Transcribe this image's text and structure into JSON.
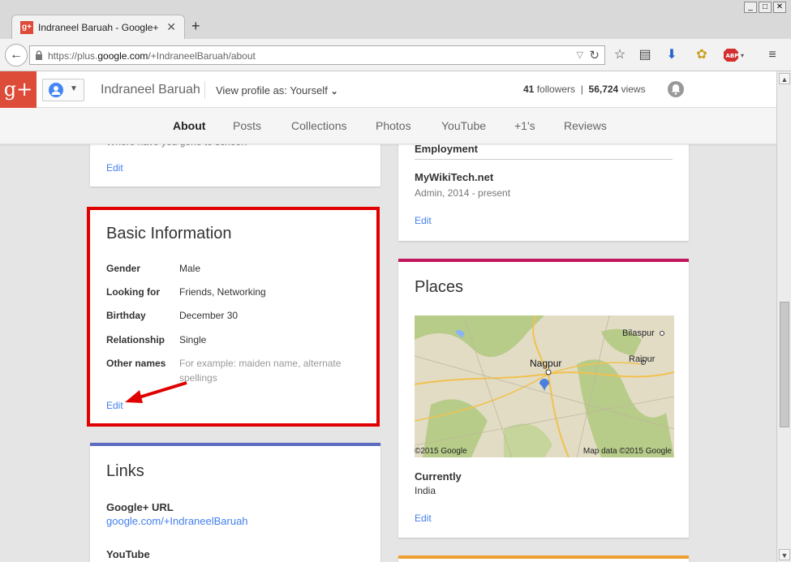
{
  "browser": {
    "tab_title": "Indraneel Baruah - Google+",
    "favicon_text": "g+",
    "url_prefix": "https://plus.",
    "url_domain": "google.com",
    "url_path": "/+IndraneelBaruah/about"
  },
  "header": {
    "logo": "g+",
    "profile_name": "Indraneel Baruah",
    "view_as_label": "View profile as:",
    "view_as_value": "Yourself",
    "followers_count": "41",
    "followers_label": "followers",
    "views_count": "56,724",
    "views_label": "views"
  },
  "profile_tabs": [
    {
      "label": "About"
    },
    {
      "label": "Posts"
    },
    {
      "label": "Collections"
    },
    {
      "label": "Photos"
    },
    {
      "label": "YouTube"
    },
    {
      "label": "+1's"
    },
    {
      "label": "Reviews"
    }
  ],
  "education_card": {
    "partial_text": "Where have you gone to school?",
    "edit_label": "Edit"
  },
  "basic_info": {
    "title": "Basic Information",
    "rows": [
      {
        "label": "Gender",
        "value": "Male"
      },
      {
        "label": "Looking for",
        "value": "Friends, Networking"
      },
      {
        "label": "Birthday",
        "value": "December 30"
      },
      {
        "label": "Relationship",
        "value": "Single"
      },
      {
        "label": "Other names",
        "value": "For example: maiden name, alternate spellings"
      }
    ],
    "edit_label": "Edit"
  },
  "links": {
    "title": "Links",
    "gplus_label": "Google+ URL",
    "gplus_url": "google.com/+IndraneelBaruah",
    "youtube_label": "YouTube"
  },
  "work": {
    "employment_label": "Employment",
    "employer": "MyWikiTech.net",
    "role": "Admin, 2014 - present",
    "edit_label": "Edit"
  },
  "places": {
    "title": "Places",
    "map_labels": [
      "Nagpur",
      "Bilaspur",
      "Raipur"
    ],
    "map_copyright_left": "©2015 Google",
    "map_copyright_right": "Map data ©2015 Google",
    "currently_label": "Currently",
    "currently_value": "India",
    "edit_label": "Edit"
  },
  "colors": {
    "gplus_red": "#dd4b39",
    "link_blue": "#427fed",
    "highlight_red": "#e00000",
    "links_accent": "#5c6bc0",
    "places_accent": "#c2185b",
    "next_accent": "#f0a030"
  }
}
